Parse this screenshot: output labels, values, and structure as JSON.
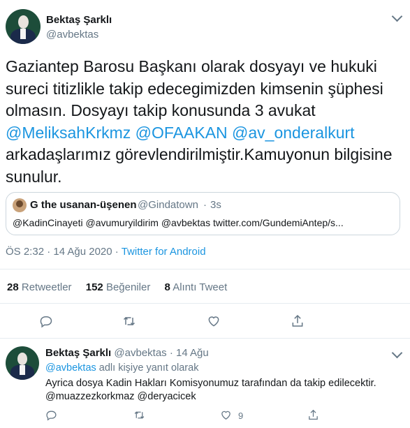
{
  "tweet": {
    "author_name": "Bektaş Şarklı",
    "author_handle": "@avbektas",
    "text_lines": [
      "Gaziantep Barosu Başkanı olarak dosyayı ve hukuki",
      "sureci titizlikle takip edecegimizden kimsenin şüphesi",
      "olmasın. Dosyayı takip konusunda 3 avukat"
    ],
    "mentions": [
      "@MeliksahKrkmz",
      "@OFAAKAN",
      "@av_onderalkurt"
    ],
    "text_lines_after": [
      "arkadaşlarımız görevlendirilmiştir.Kamuyonun bilgisine",
      "sunulur."
    ],
    "quote": {
      "name": "G the usanan-üşenen",
      "handle": "@Gindatown",
      "sep": "·",
      "time": "3s",
      "text": "@KadinCinayeti @avumuryildirim @avbektas twitter.com/GundemiAntep/s..."
    },
    "timestamp": "ÖS 2:32 · 14 Ağu 2020 ·",
    "source": "Twitter for Android",
    "stats": [
      {
        "count": "28",
        "label": "Retweetler"
      },
      {
        "count": "152",
        "label": "Beğeniler"
      },
      {
        "count": "8",
        "label": "Alıntı Tweet"
      }
    ],
    "action_icons": [
      "reply-icon",
      "retweet-icon",
      "like-icon",
      "share-icon"
    ]
  },
  "reply": {
    "author_name": "Bektaş Şarklı",
    "author_meta": "@avbektas · 14 Ağu",
    "replying_to_mention": "@avbektas",
    "replying_to_text": "adlı kişiye yanıt olarak",
    "text": "Ayrica dosya Kadin Hakları Komisyonumuz tarafından da takip edilecektir.",
    "mentions": "@muazzezkorkmaz @deryacicek",
    "like_count": "9"
  },
  "colors": {
    "accent": "#1b95e0",
    "muted": "#657786",
    "text": "#14171a",
    "border": "#e6ecf0"
  }
}
